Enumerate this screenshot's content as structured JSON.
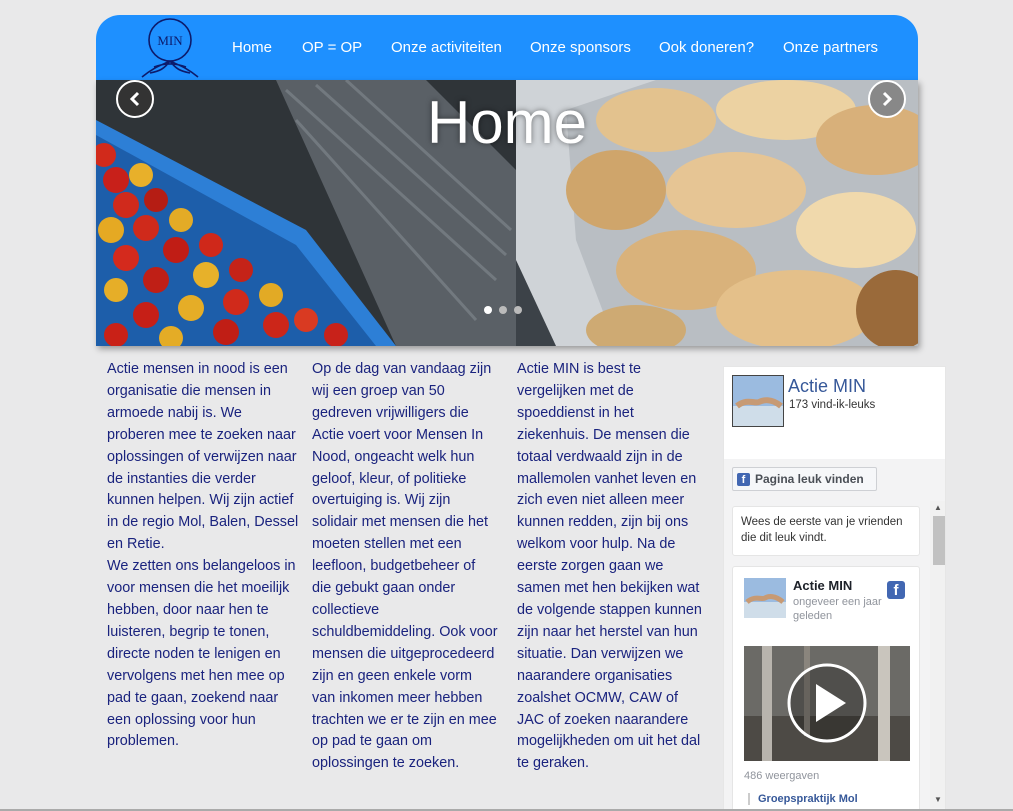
{
  "header": {
    "logo_text": "MIN",
    "nav": [
      {
        "label": "Home"
      },
      {
        "label": "OP = OP"
      },
      {
        "label": "Onze activiteiten"
      },
      {
        "label": "Onze sponsors"
      },
      {
        "label": "Ook doneren?"
      },
      {
        "label": "Onze partners"
      }
    ],
    "color": "#1e90ff"
  },
  "slider": {
    "title": "Home",
    "prev_icon": "chevron-left-icon",
    "next_icon": "chevron-right-icon",
    "slide_count": 3,
    "active_slide": 1
  },
  "columns": [
    {
      "paragraphs": [
        "Actie mensen in nood is een organisatie die mensen in armoede nabij is. We proberen mee te zoeken naar oplossingen of verwijzen naar de instanties die verder kunnen helpen. Wij zijn actief in de regio Mol, Balen, Dessel en Retie.",
        "We zetten ons belangeloos in voor mensen die het moeilijk hebben, door naar hen te luisteren, begrip te tonen, directe noden te lenigen en vervolgens met hen mee op pad te gaan, zoekend naar een oplossing voor hun problemen."
      ]
    },
    {
      "paragraphs": [
        "Op de dag van vandaag zijn wij een groep van 50 gedreven vrijwilligers die Actie voert voor Mensen In Nood, ongeacht welk hun geloof, kleur, of politieke overtuiging is. Wij zijn solidair met mensen die het moeten stellen met een leefloon, budgetbeheer of die gebukt gaan onder collectieve schuldbemiddeling. Ook voor mensen die uitgeprocedeerd zijn en geen enkele vorm van inkomen meer hebben trachten we er te zijn en mee op pad te gaan om oplossingen te zoeken."
      ]
    },
    {
      "paragraphs": [
        "Actie MIN is best te vergelijken met de spoeddienst in het ziekenhuis. De mensen die totaal verdwaald zijn in de mallemolen vanhet leven en zich even niet alleen meer kunnen redden, zijn bij ons welkom voor hulp. Na de eerste zorgen gaan we samen met hen bekijken wat de volgende stappen kunnen zijn naar het herstel van hun situatie. Dan verwijzen we naarandere organisaties zoalshet OCMW, CAW of JAC of zoeken naarandere mogelijkheden om uit het dal te geraken."
      ]
    }
  ],
  "facebook": {
    "page_name": "Actie MIN",
    "likes": "173 vind-ik-leuks",
    "like_button": "Pagina leuk vinden",
    "friends_note": "Wees de eerste van je vrienden die dit leuk vindt.",
    "post": {
      "author": "Actie MIN",
      "time": "ongeveer een jaar geleden",
      "views": "486 weergaven",
      "shared_from": "Groepspraktijk Mol"
    },
    "brand_color": "#4267b2"
  }
}
